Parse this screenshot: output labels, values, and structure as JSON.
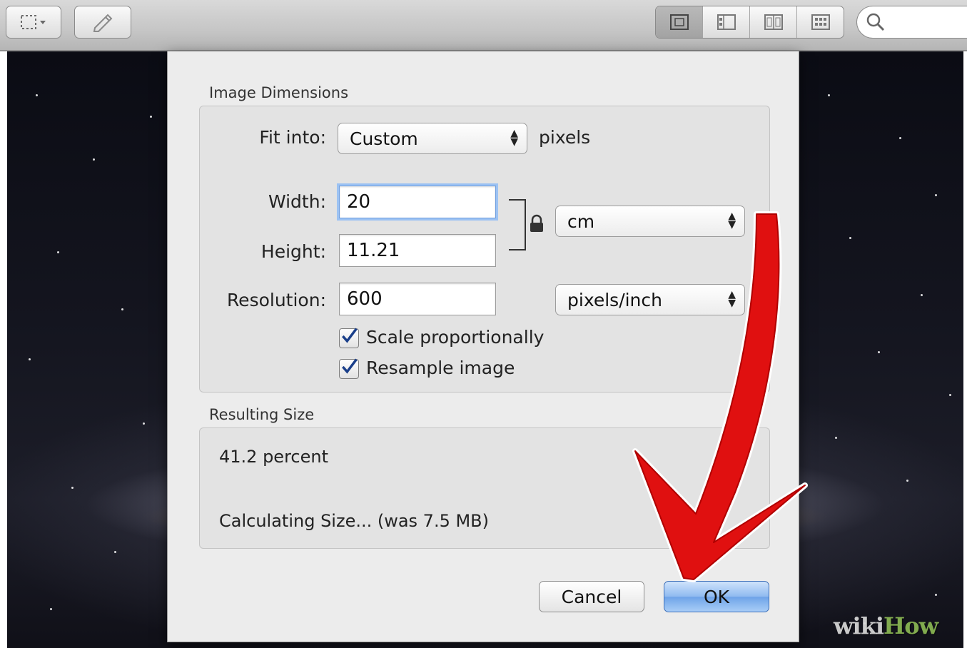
{
  "toolbar": {
    "search_placeholder": ""
  },
  "dialog": {
    "dimensions_title": "Image Dimensions",
    "fit_into_label": "Fit into:",
    "fit_into_value": "Custom",
    "fit_into_unit": "pixels",
    "width_label": "Width:",
    "width_value": "20",
    "height_label": "Height:",
    "height_value": "11.21",
    "resolution_label": "Resolution:",
    "resolution_value": "600",
    "size_unit_value": "cm",
    "resolution_unit_value": "pixels/inch",
    "scale_proportionally_label": "Scale proportionally",
    "scale_proportionally_checked": true,
    "resample_label": "Resample image",
    "resample_checked": true,
    "resulting_title": "Resulting Size",
    "percent_text": "41.2 percent",
    "calculating_text": "Calculating Size... (was 7.5 MB)",
    "cancel_label": "Cancel",
    "ok_label": "OK"
  },
  "watermark": {
    "wiki": "wiki",
    "how": "How"
  },
  "colors": {
    "accent_blue": "#6ea3e8",
    "arrow_red": "#e01010"
  }
}
